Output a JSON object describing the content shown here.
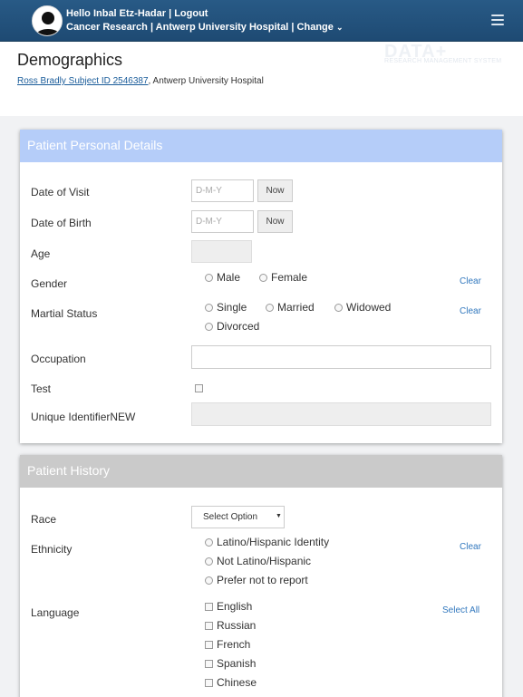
{
  "topbar": {
    "greeting": "Hello Inbal Etz-Hadar | Logout",
    "context": "Cancer Research | Antwerp University Hospital | Change",
    "change_chevron": "⌄",
    "avatar_icon": "user-silhouette-icon",
    "menu_icon": "hamburger-menu-icon"
  },
  "header": {
    "title": "Demographics",
    "subject_link": "Ross Bradly Subject ID 2546387",
    "subject_suffix": ", Antwerp University Hospital",
    "watermark": "DATA+",
    "watermark_sub": "RESEARCH MANAGEMENT SYSTEM"
  },
  "personal": {
    "title": "Patient Personal Details",
    "visit_label": "Date of Visit",
    "birth_label": "Date of Birth",
    "date_placeholder": "D-M-Y",
    "now_label": "Now",
    "age_label": "Age",
    "gender_label": "Gender",
    "gender_options": [
      "Male",
      "Female"
    ],
    "clear_label": "Clear",
    "marital_label": "Martial Status",
    "marital_options": [
      "Single",
      "Married",
      "Widowed",
      "Divorced"
    ],
    "occupation_label": "Occupation",
    "test_label": "Test",
    "unique_label": "Unique IdentifierNEW"
  },
  "history": {
    "title": "Patient History",
    "race_label": "Race",
    "race_select": "Select Option",
    "select_arrow": "▼",
    "ethnicity_label": "Ethnicity",
    "ethnicity_options": [
      "Latino/Hispanic Identity",
      "Not Latino/Hispanic",
      "Prefer not to report"
    ],
    "clear_label": "Clear",
    "language_label": "Language",
    "select_all_label": "Select All",
    "language_options": [
      "English",
      "Russian",
      "French",
      "Spanish",
      "Chinese"
    ]
  },
  "colors": {
    "topbar": "#285a86",
    "personal_header": "#b5cdf9",
    "history_header": "#cacaca",
    "link": "#3278be"
  }
}
